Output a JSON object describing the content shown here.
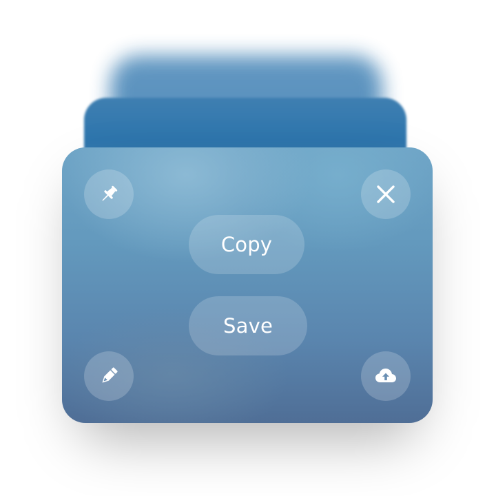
{
  "colors": {
    "card_top": "#6ea4c6",
    "card_bottom": "#4f6e96",
    "back_card": "#2e76ae",
    "button_fill": "rgba(255,255,255,0.2)",
    "text": "#ffffff"
  },
  "actions": {
    "copy_label": "Copy",
    "save_label": "Save"
  },
  "icons": {
    "top_left": "pin-icon",
    "top_right": "close-icon",
    "bottom_left": "pencil-icon",
    "bottom_right": "cloud-upload-icon"
  }
}
